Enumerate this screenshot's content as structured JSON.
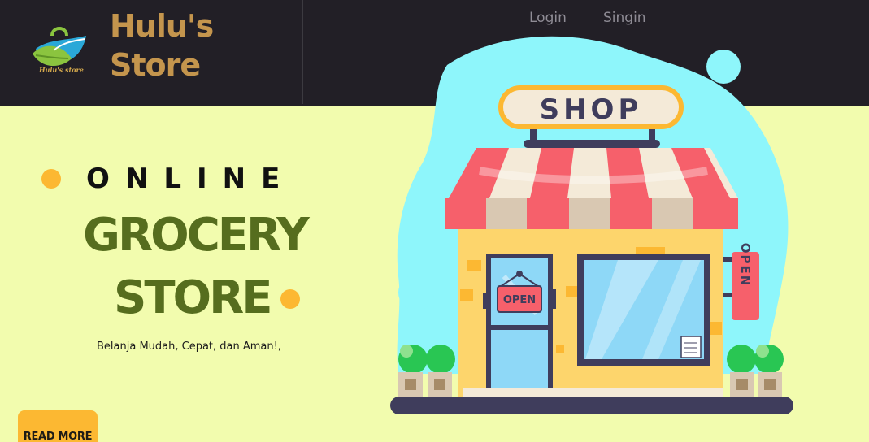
{
  "brand": {
    "title": "Hulu's Store",
    "logo_caption": "Hulu's store",
    "logo_icon": "shopping-bag-leaf-icon"
  },
  "nav": {
    "links": [
      "Login",
      "Singin"
    ]
  },
  "hero": {
    "kicker": "ONLINE",
    "heading_line1": "GROCERY",
    "heading_line2": "STORE",
    "tagline": "Belanja Mudah, Cepat, dan Aman!,",
    "cta_label": "READ MORE"
  },
  "illustration": {
    "sign_text": "SHOP",
    "door_sign_text": "OPEN",
    "side_sign_text": "OPEN"
  },
  "colors": {
    "navbar": "#221f26",
    "hero_bg": "#f2fcae",
    "brand": "#c4954d",
    "heading": "#566d1e",
    "accent": "#fcb832",
    "nav_link": "#8f8c95"
  }
}
